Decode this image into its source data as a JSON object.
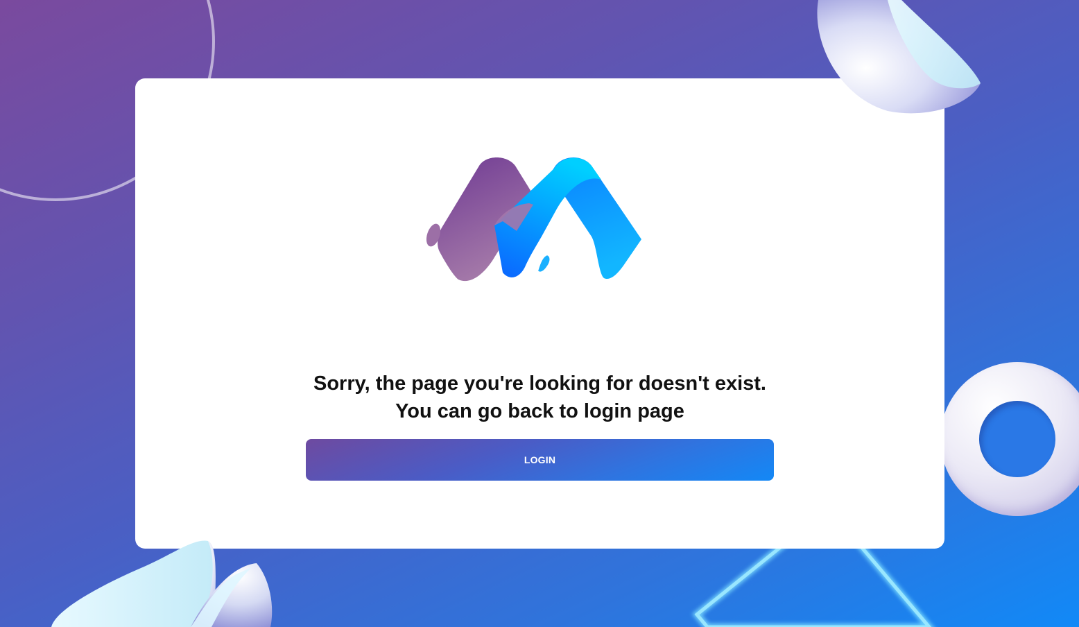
{
  "message": {
    "line1": "Sorry, the page you're looking for doesn't exist.",
    "line2": "You can go back to login page"
  },
  "login_button": {
    "label": "LOGIN"
  },
  "colors": {
    "background_start": "#7a4a9e",
    "background_end": "#1189f7",
    "card": "#ffffff",
    "logo_purple": "#8e5a9e",
    "logo_blue": "#0a88ff",
    "logo_cyan": "#00c8ff"
  },
  "icons": {
    "logo": "brand-m-logo-icon"
  }
}
